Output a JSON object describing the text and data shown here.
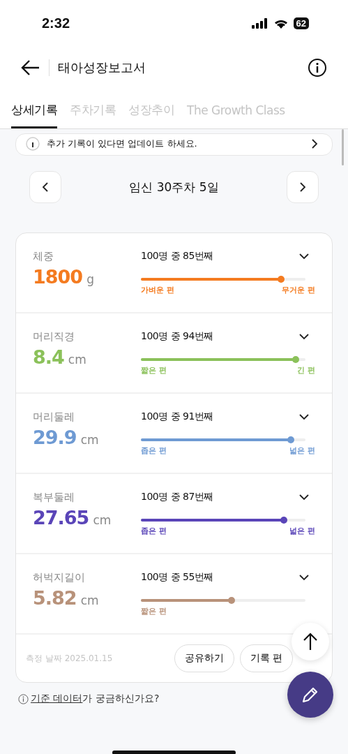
{
  "status_bar": {
    "time": "2:32",
    "battery": "62"
  },
  "header": {
    "title": "태아성장보고서"
  },
  "tabs": [
    {
      "label": "상세기록",
      "selected": true
    },
    {
      "label": "주차기록",
      "selected": false
    },
    {
      "label": "성장추이",
      "selected": false
    },
    {
      "label": "The Growth Class",
      "selected": false
    }
  ],
  "notice": {
    "text": "추가 기록이 있다면 업데이트 하세요."
  },
  "week_nav": {
    "label": "임신 30주차 5일"
  },
  "metrics": [
    {
      "label": "체중",
      "value": "1800",
      "unit": "g",
      "rank": "100명 중 85번째",
      "level": 0.85,
      "color": "#f47b20",
      "low_label": "가벼운 편",
      "high_label": "무거운 편"
    },
    {
      "label": "머리직경",
      "value": "8.4",
      "unit": "cm",
      "rank": "100명 중 94번째",
      "level": 0.94,
      "color": "#8bc15a",
      "low_label": "짧은 편",
      "high_label": "긴 편"
    },
    {
      "label": "머리둘레",
      "value": "29.9",
      "unit": "cm",
      "rank": "100명 중 91번째",
      "level": 0.91,
      "color": "#6e9ad3",
      "low_label": "좁은 편",
      "high_label": "넓은 편"
    },
    {
      "label": "복부둘레",
      "value": "27.65",
      "unit": "cm",
      "rank": "100명 중 87번째",
      "level": 0.87,
      "color": "#5a45b8",
      "low_label": "좁은 편",
      "high_label": "넓은 편"
    },
    {
      "label": "허벅지길이",
      "value": "5.82",
      "unit": "cm",
      "rank": "100명 중 55번째",
      "level": 0.55,
      "color": "#b8927a",
      "low_label": "짧은 편"
    }
  ],
  "footer": {
    "date": "측정 날짜 2025.01.15",
    "buttons": [
      "공유하기",
      "기록 편"
    ]
  },
  "help": {
    "link": "기준 데이터",
    "text": "가 궁금하신가요?"
  }
}
